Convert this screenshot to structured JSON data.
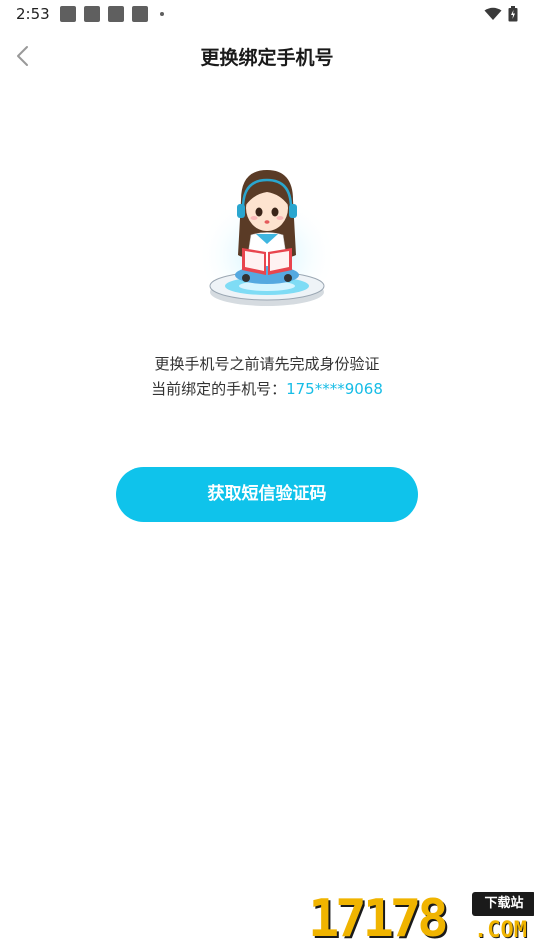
{
  "status_bar": {
    "time": "2:53",
    "notification_icons": [
      "notification-icon",
      "notification-icon",
      "notification-icon",
      "notification-icon"
    ]
  },
  "header": {
    "title": "更换绑定手机号",
    "back_icon": "chevron-left-icon"
  },
  "illustration": {
    "name": "reading-girl-illustration"
  },
  "info": {
    "line1": "更换手机号之前请先完成身份验证",
    "line2_label": "当前绑定的手机号：",
    "phone": "175****9068"
  },
  "action": {
    "button_label": "获取短信验证码"
  },
  "watermark": {
    "number": "17178",
    "tag": "下载站",
    "domain": ".COM"
  },
  "colors": {
    "accent": "#0fc3eb",
    "phone_text": "#17bde6",
    "watermark": "#f0b400"
  }
}
